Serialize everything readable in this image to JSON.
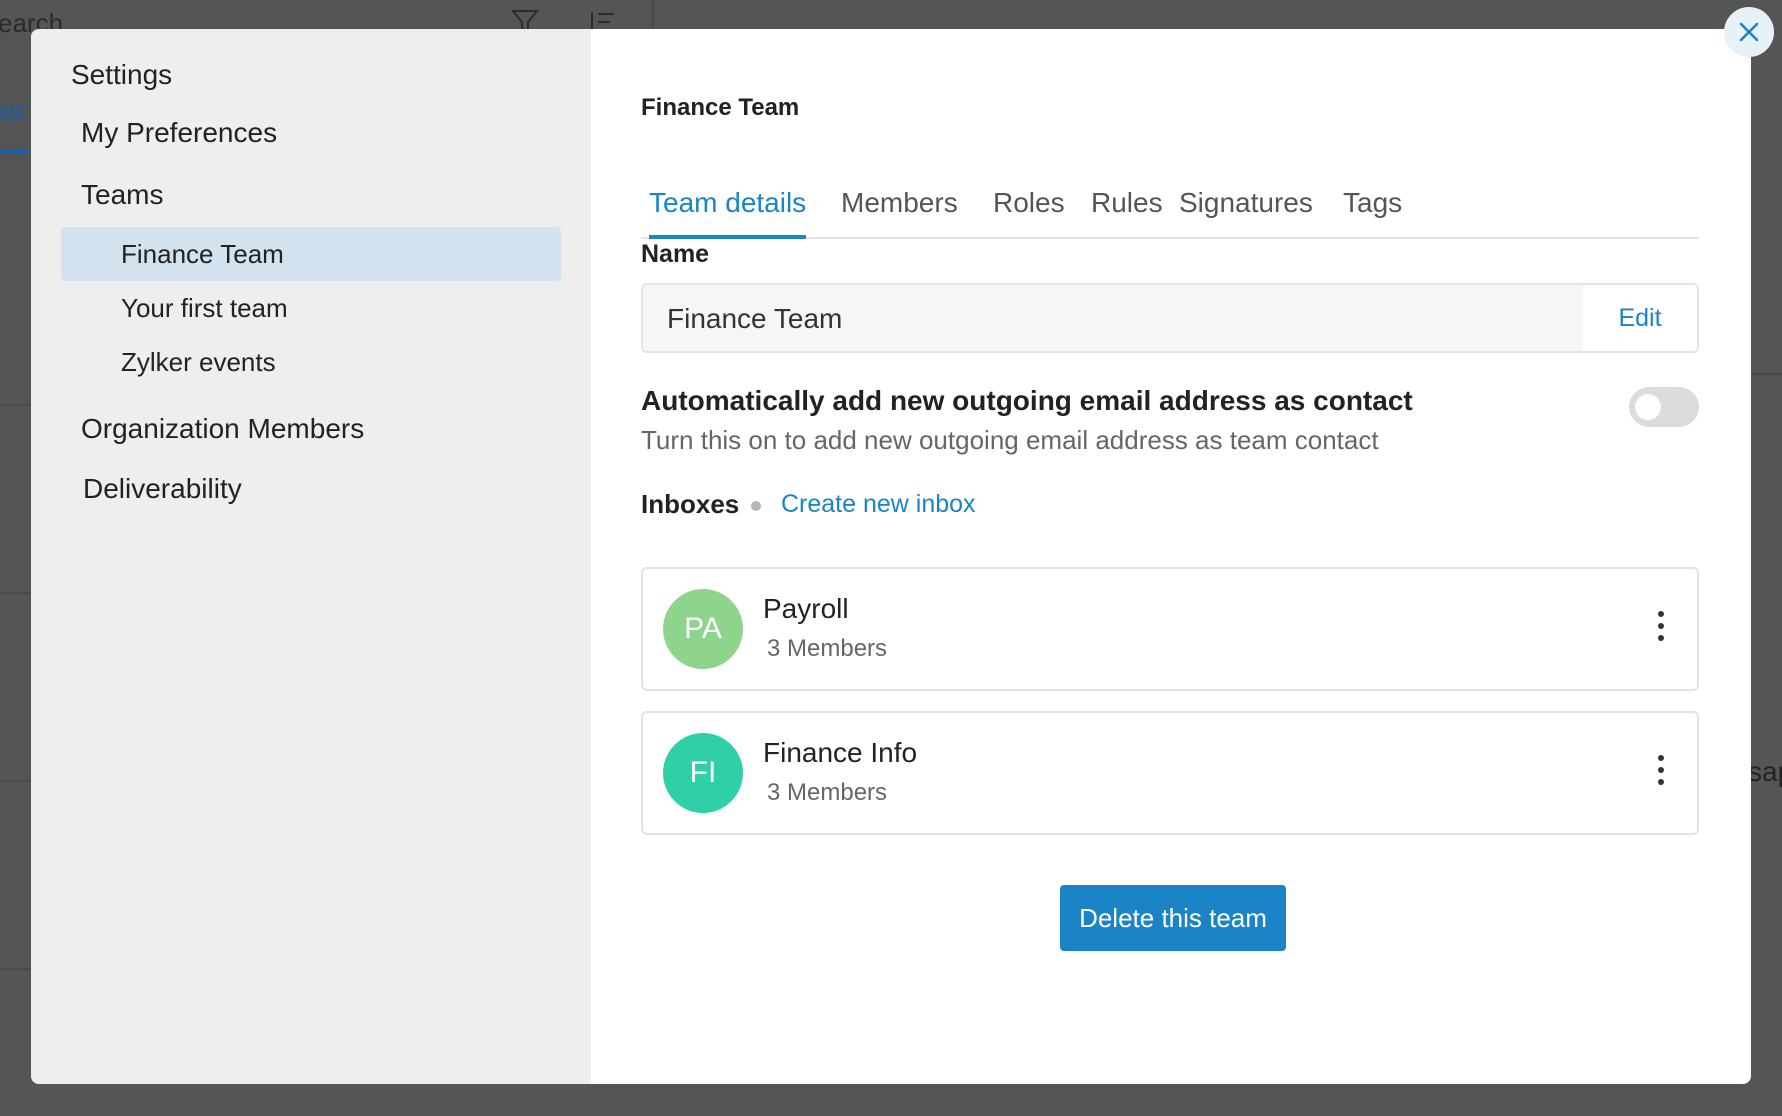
{
  "background": {
    "search_text": "earch",
    "tab_fragment": "as:",
    "right_fragment": "sap"
  },
  "sidebar": {
    "title": "Settings",
    "items": [
      {
        "label": "My Preferences"
      },
      {
        "label": "Teams"
      },
      {
        "label": "Organization Members"
      },
      {
        "label": "Deliverability"
      }
    ],
    "teams": [
      {
        "label": "Finance Team",
        "active": true
      },
      {
        "label": "Your first team",
        "active": false
      },
      {
        "label": "Zylker events",
        "active": false
      }
    ]
  },
  "main": {
    "title": "Finance Team",
    "tabs": [
      {
        "label": "Team details",
        "active": true
      },
      {
        "label": "Members",
        "active": false
      },
      {
        "label": "Roles",
        "active": false
      },
      {
        "label": "Rules",
        "active": false
      },
      {
        "label": "Signatures",
        "active": false
      },
      {
        "label": "Tags",
        "active": false
      }
    ],
    "name_section": {
      "label": "Name",
      "value": "Finance Team",
      "edit_label": "Edit"
    },
    "auto_contact": {
      "title": "Automatically add new outgoing email address as contact",
      "description": "Turn this on to add new outgoing email address as team contact",
      "enabled": false
    },
    "inboxes": {
      "label": "Inboxes",
      "create_label": "Create new inbox",
      "items": [
        {
          "initials": "PA",
          "name": "Payroll",
          "members": "3 Members",
          "color": "#8fd48c"
        },
        {
          "initials": "FI",
          "name": "Finance Info",
          "members": "3 Members",
          "color": "#2fcfa8"
        }
      ]
    },
    "delete_label": "Delete this team"
  },
  "colors": {
    "accent": "#1a84c6",
    "sidebar_bg": "#eeeeee",
    "active_item_bg": "#d2e2ee"
  },
  "icons": {
    "close": "close-icon",
    "more": "more-vertical-icon",
    "filter": "filter-icon",
    "sort": "sort-icon"
  }
}
